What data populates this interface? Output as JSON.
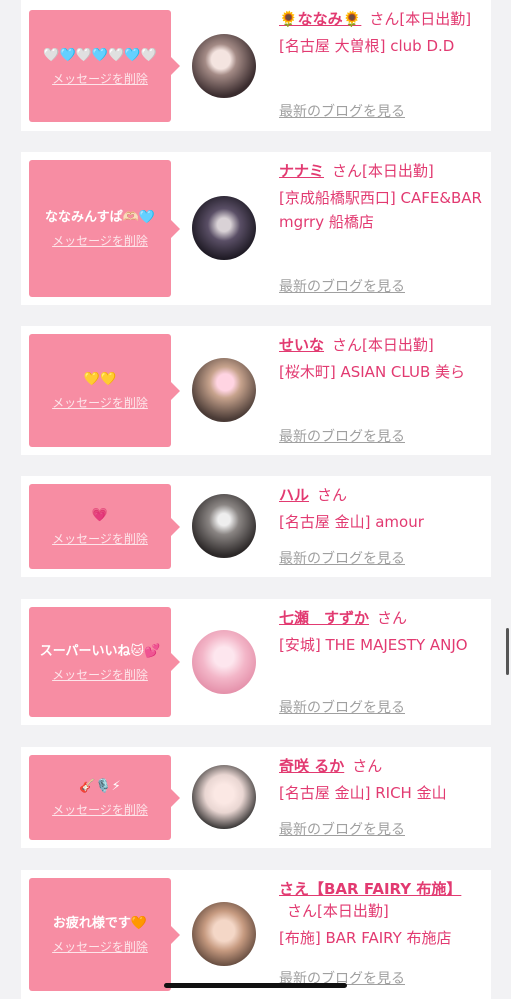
{
  "delete_label": "メッセージを削除",
  "blog_label": "最新のブログを見る",
  "honorific": "さん",
  "cards": [
    {
      "message": "🤍🩵🤍🩵🤍🩵🤍",
      "name": "🌻ななみ🌻",
      "status": "[本日出勤]",
      "shop": "[名古屋 大曽根] club D.D",
      "avatar": "avatar-1"
    },
    {
      "message": "ななみんすぱ🫶🏻🩵",
      "name": "ナナミ",
      "status": "[本日出勤]",
      "shop": "[京成船橋駅西口] CAFE&BAR mgrry 船橋店",
      "avatar": "avatar-2"
    },
    {
      "message": "💛💛",
      "name": "せいな",
      "status": "[本日出勤]",
      "shop": "[桜木町] ASIAN CLUB 美ら",
      "avatar": "avatar-3"
    },
    {
      "message": "💗",
      "name": "ハル",
      "status": "",
      "shop": "[名古屋 金山] amour",
      "avatar": "avatar-4"
    },
    {
      "message": "スーパーいいね🐱💕",
      "name": "七瀬　すずか",
      "status": "",
      "shop": "[安城] THE MAJESTY ANJO",
      "avatar": "avatar-5"
    },
    {
      "message": "🎸🎙️⚡",
      "name": "奇咲 るか",
      "status": "",
      "shop": "[名古屋 金山] RICH 金山",
      "avatar": "avatar-6"
    },
    {
      "message": "お疲れ様です🧡",
      "name": "さえ【BAR FAIRY 布施】",
      "status": "[本日出勤]",
      "shop": "[布施] BAR FAIRY 布施店",
      "avatar": "avatar-7"
    }
  ]
}
